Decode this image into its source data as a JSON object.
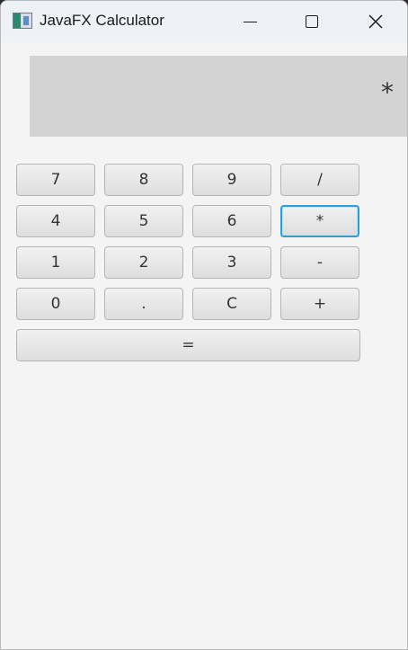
{
  "window": {
    "title": "JavaFX Calculator"
  },
  "display": {
    "value": "*"
  },
  "keypad": {
    "rows": [
      [
        "7",
        "8",
        "9",
        "/"
      ],
      [
        "4",
        "5",
        "6",
        "*"
      ],
      [
        "1",
        "2",
        "3",
        "-"
      ],
      [
        "0",
        ".",
        "C",
        "+"
      ]
    ],
    "equals": "=",
    "focused_key": "*"
  },
  "colors": {
    "titlebar": "#eef2f6",
    "window_bg": "#f4f4f4",
    "display_bg": "#d3d3d3",
    "focus_ring": "#2a9fd6"
  }
}
